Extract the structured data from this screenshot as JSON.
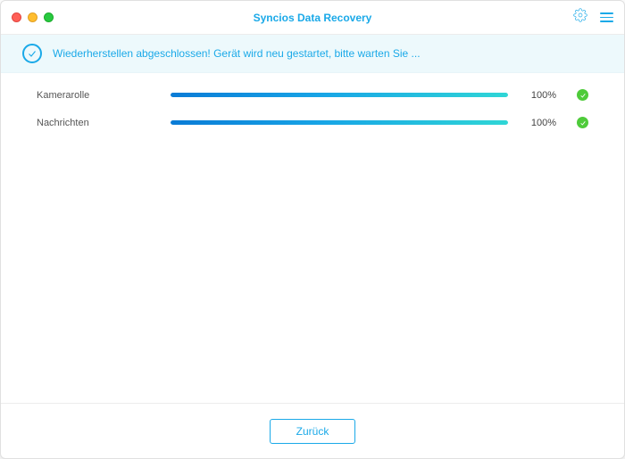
{
  "header": {
    "title": "Syncios Data Recovery",
    "icons": {
      "settings": "gear-icon",
      "menu": "menu-icon"
    }
  },
  "status": {
    "icon": "check-circle-icon",
    "message": "Wiederherstellen abgeschlossen! Gerät wird neu gestartet, bitte warten Sie ..."
  },
  "progress_rows": [
    {
      "label": "Kamerarolle",
      "percent_text": "100%",
      "percent_value": 100,
      "complete": true
    },
    {
      "label": "Nachrichten",
      "percent_text": "100%",
      "percent_value": 100,
      "complete": true
    }
  ],
  "footer": {
    "back_label": "Zurück"
  },
  "colors": {
    "accent": "#1aa9e8",
    "success": "#4ecb3a"
  }
}
